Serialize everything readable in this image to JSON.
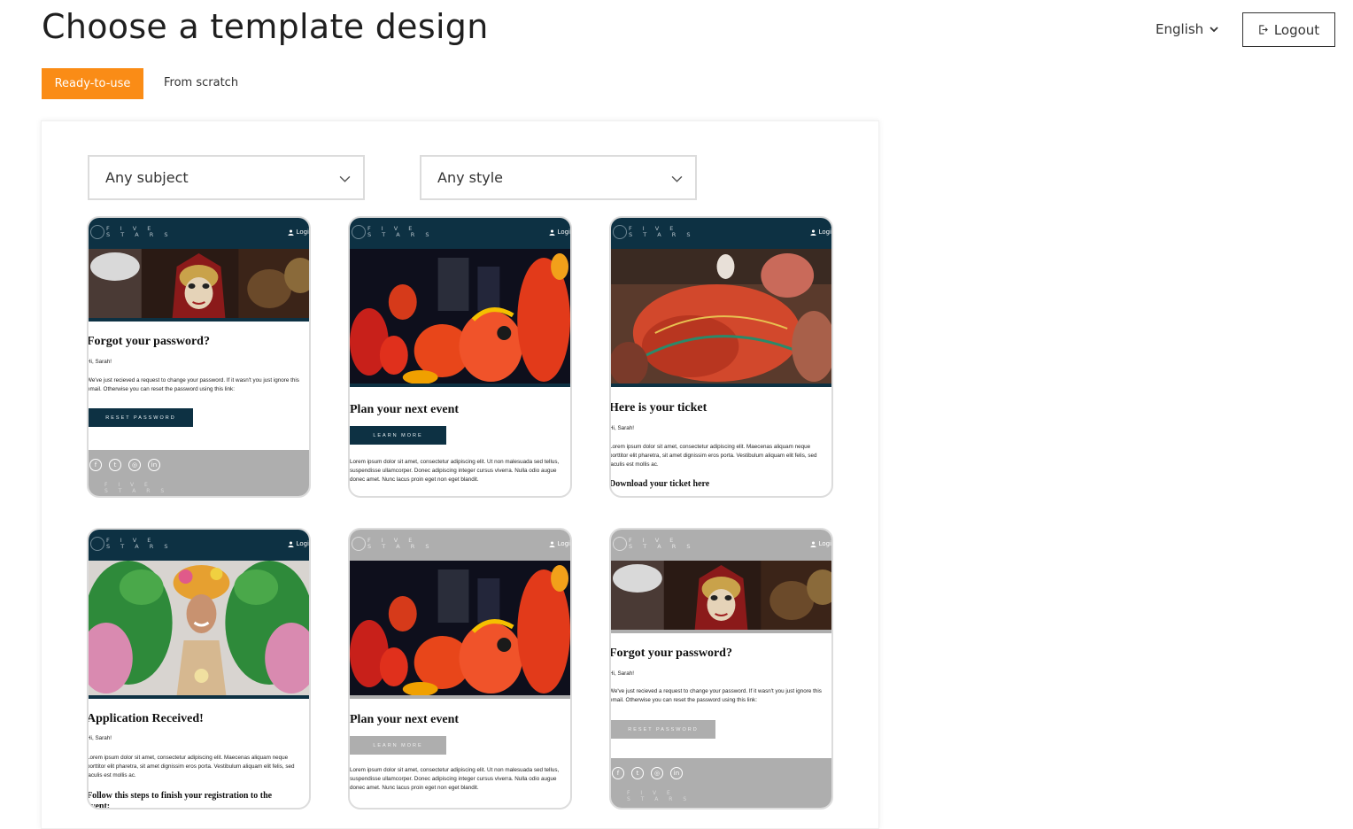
{
  "header": {
    "title": "Choose a template design",
    "language": "English",
    "logout_label": "Logout"
  },
  "tabs": {
    "ready_label": "Ready-to-use",
    "scratch_label": "From scratch",
    "active_color": "#fa8c16"
  },
  "filters": {
    "subject": "Any subject",
    "style": "Any style"
  },
  "template_brand": "F I V E\nS T A R S",
  "template_login": "Logi",
  "cards": [
    {
      "title": "Forgot your password?",
      "greeting": "Hi, Sarah!",
      "body": "We've just recieved a request to change your password. If it wasn't you just ignore this email. Otherwise you can reset the password using this link:",
      "button": "RESET PASSWORD"
    },
    {
      "title": "Plan your next event",
      "button": "LEARN MORE",
      "body": "Lorem ipsum dolor sit amet, consectetur adipiscing elit. Ut non malesuada sed tellus, suspendisse ullamcorper. Donec adipiscing integer cursus viverra. Nulla odio augue donec amet. Nunc lacus proin eget non eget blandit."
    },
    {
      "title": "Here is your ticket",
      "greeting": "Hi, Sarah!",
      "body": "Lorem ipsum dolor sit amet, consectetur adipiscing elit. Maecenas aliquam neque porttitor elit pharetra, sit amet dignissim eros porta. Vestibulum aliquam elit felis, sed iaculis est mollis ac.",
      "footer_text": "Download your ticket here"
    },
    {
      "title": "Application Received!",
      "greeting": "Hi, Sarah!",
      "body": "Lorem ipsum dolor sit amet, consectetur adipiscing elit. Maecenas aliquam neque porttitor elit pharetra, sit amet dignissim eros porta. Vestibulum aliquam elit felis, sed iaculis est mollis ac.",
      "footer_text": "Follow this steps to finish your registration to the event:"
    },
    {
      "title": "Plan your next event",
      "button": "LEARN MORE",
      "body": "Lorem ipsum dolor sit amet, consectetur adipiscing elit. Ut non malesuada sed tellus, suspendisse ullamcorper. Donec adipiscing integer cursus viverra. Nulla odio augue donec amet. Nunc lacus proin eget non eget blandit."
    },
    {
      "title": "Forgot your password?",
      "greeting": "Hi, Sarah!",
      "body": "We've just recieved a request to change your password. If it wasn't you just ignore this email. Otherwise you can reset the password using this link:",
      "button": "RESET PASSWORD"
    }
  ]
}
